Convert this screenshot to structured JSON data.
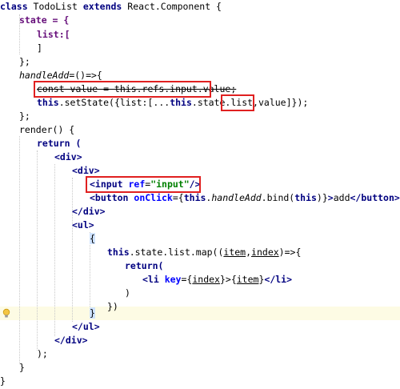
{
  "code": {
    "l1_kw1": "class",
    "l1_name": " TodoList ",
    "l1_kw2": "extends",
    "l1_rest": " React.Component {",
    "l2": "state = {",
    "l3": "list:[",
    "l4": "]",
    "l5": "};",
    "l6_name": "handleAdd",
    "l6_rest": "=()=>{",
    "l7": "const value = this.refs.input.value;",
    "l8_this": "this",
    "l8_mid": ".setState({list:[...",
    "l8_this2": "this",
    "l8_mid2": ".state.list,",
    "l8_val": "value",
    "l8_end": "]});",
    "l9": "};",
    "l10": "render() {",
    "l11": "return (",
    "l12": "<div>",
    "l13": "<div>",
    "l14_open": "<input ",
    "l14_attr": "ref",
    "l14_eq": "=",
    "l14_str": "\"input\"",
    "l14_close": "/>",
    "l15_open": "<button ",
    "l15_attr": "onClick",
    "l15_eq": "={",
    "l15_this": "this",
    "l15_dot": ".",
    "l15_method": "handleAdd",
    "l15_bind": ".bind(",
    "l15_this2": "this",
    "l15_end": ")}",
    "l15_gt": ">",
    "l15_text": "add",
    "l15_closetag": "</button>",
    "l16": "</div>",
    "l17": "<ul>",
    "l18": "{",
    "l19_this": "this",
    "l19_rest": ".state.list.map((",
    "l19_item": "item",
    "l19_comma": ",",
    "l19_index": "index",
    "l19_end": ")=>{",
    "l20": "return(",
    "l21_open": "<li ",
    "l21_attr": "key",
    "l21_eq": "={",
    "l21_index": "index",
    "l21_mid": "}>{",
    "l21_item": "item",
    "l21_mid2": "}",
    "l21_close": "</li>",
    "l22": ")",
    "l23": "})",
    "l24": "}",
    "l25": "</ul>",
    "l26": "</div>",
    "l27": ");",
    "l28": "}",
    "l29": "}"
  },
  "colors": {
    "keyword": "#000080",
    "field": "#660e7a",
    "string": "#008000",
    "attribute": "#0000ff",
    "annotation_box": "#e02020",
    "current_line": "#fdfbe4",
    "brace_match": "#cfe3ff"
  },
  "icons": {
    "gutter": "lightbulb-icon"
  }
}
